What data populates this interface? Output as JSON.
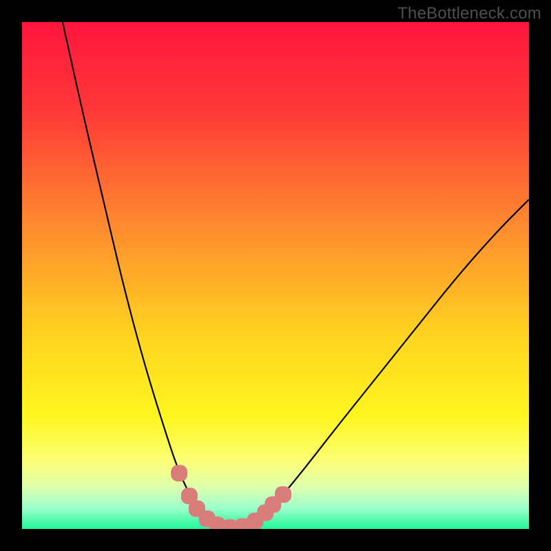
{
  "watermark": "TheBottleneck.com",
  "chart_data": {
    "type": "line",
    "title": "",
    "xlabel": "",
    "ylabel": "",
    "xlim": [
      0,
      100
    ],
    "ylim": [
      0,
      100
    ],
    "grid": false,
    "legend": false,
    "gradient_stops": [
      {
        "offset": 0,
        "color": "#ff153e"
      },
      {
        "offset": 0.18,
        "color": "#ff3a37"
      },
      {
        "offset": 0.4,
        "color": "#ff8a2f"
      },
      {
        "offset": 0.62,
        "color": "#ffd41f"
      },
      {
        "offset": 0.78,
        "color": "#fff620"
      },
      {
        "offset": 0.87,
        "color": "#fbff7a"
      },
      {
        "offset": 0.92,
        "color": "#dcffb1"
      },
      {
        "offset": 0.96,
        "color": "#99ffcb"
      },
      {
        "offset": 1.0,
        "color": "#22f59b"
      }
    ],
    "series": [
      {
        "name": "bottleneck-curve",
        "style": "solid-black",
        "points": [
          {
            "x": 8.0,
            "y": 100.0
          },
          {
            "x": 12.0,
            "y": 82.0
          },
          {
            "x": 16.0,
            "y": 65.0
          },
          {
            "x": 20.0,
            "y": 48.0
          },
          {
            "x": 24.0,
            "y": 33.0
          },
          {
            "x": 28.0,
            "y": 20.0
          },
          {
            "x": 31.0,
            "y": 11.0
          },
          {
            "x": 34.0,
            "y": 5.0
          },
          {
            "x": 37.0,
            "y": 1.5
          },
          {
            "x": 40.0,
            "y": 0.3
          },
          {
            "x": 43.0,
            "y": 0.3
          },
          {
            "x": 46.0,
            "y": 1.5
          },
          {
            "x": 50.0,
            "y": 5.0
          },
          {
            "x": 55.0,
            "y": 11.0
          },
          {
            "x": 62.0,
            "y": 20.0
          },
          {
            "x": 70.0,
            "y": 30.0
          },
          {
            "x": 78.0,
            "y": 40.0
          },
          {
            "x": 86.0,
            "y": 50.0
          },
          {
            "x": 94.0,
            "y": 59.0
          },
          {
            "x": 100.0,
            "y": 65.0
          }
        ]
      },
      {
        "name": "sample-markers",
        "style": "rounded-square-pink",
        "color": "#d87d7a",
        "points": [
          {
            "x": 31.0,
            "y": 11.0
          },
          {
            "x": 33.0,
            "y": 6.5
          },
          {
            "x": 34.5,
            "y": 4.0
          },
          {
            "x": 36.5,
            "y": 2.0
          },
          {
            "x": 38.5,
            "y": 0.8
          },
          {
            "x": 41.0,
            "y": 0.3
          },
          {
            "x": 43.5,
            "y": 0.5
          },
          {
            "x": 46.0,
            "y": 1.6
          },
          {
            "x": 48.0,
            "y": 3.2
          },
          {
            "x": 49.5,
            "y": 4.8
          },
          {
            "x": 51.5,
            "y": 6.8
          }
        ]
      }
    ]
  }
}
